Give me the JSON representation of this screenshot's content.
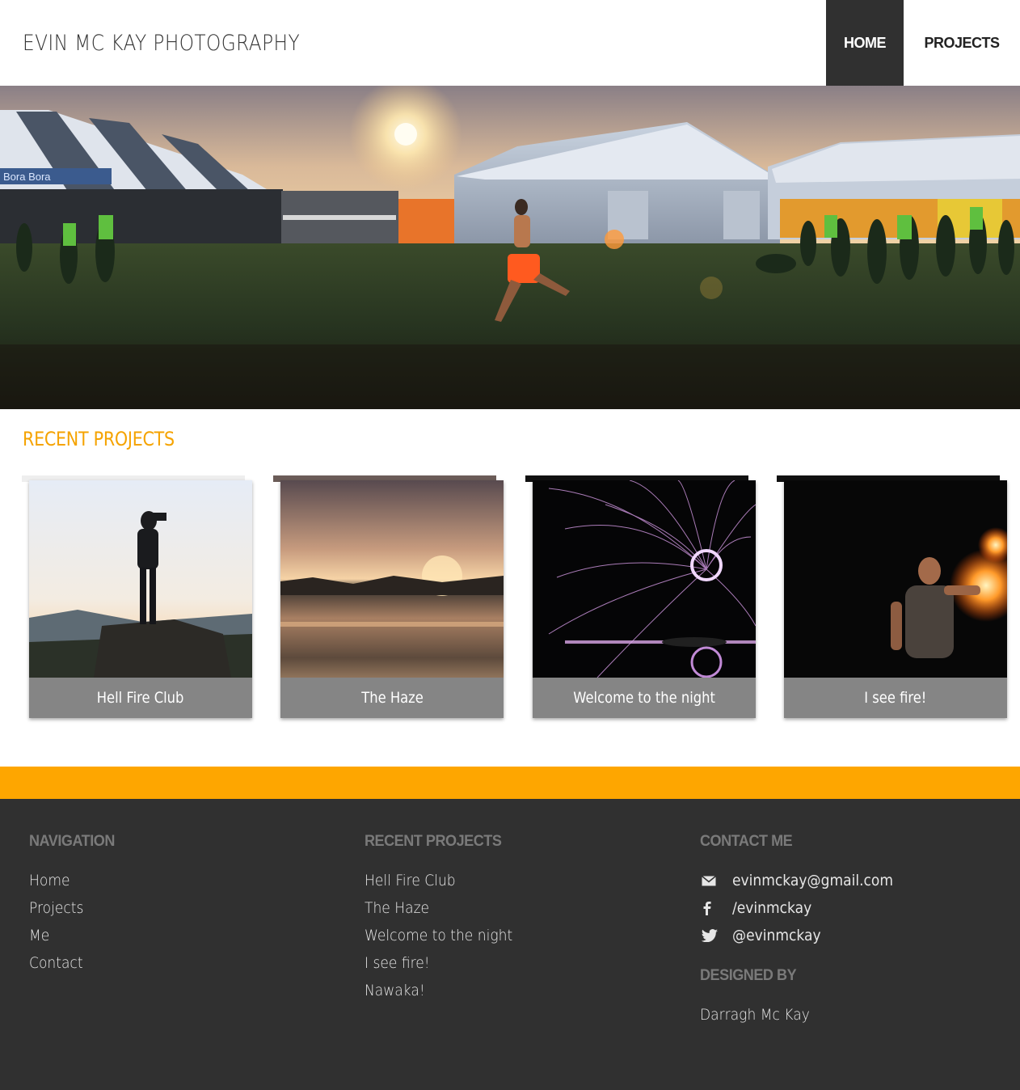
{
  "header": {
    "brand": "EVIN MC KAY PHOTOGRAPHY",
    "nav": [
      {
        "label": "HOME",
        "active": true
      },
      {
        "label": "PROJECTS",
        "active": false
      }
    ]
  },
  "hero": {
    "alt": "Festival campsite at sunset with a runner crossing the field",
    "sign_text": "Bora Bora"
  },
  "recent": {
    "title": "RECENT PROJECTS",
    "projects": [
      {
        "caption": "Hell Fire Club"
      },
      {
        "caption": "The Haze"
      },
      {
        "caption": "Welcome to the night"
      },
      {
        "caption": "I see fire!"
      }
    ]
  },
  "footer": {
    "navigation": {
      "heading": "NAVIGATION",
      "links": [
        "Home",
        "Projects",
        "Me",
        "Contact"
      ]
    },
    "recent_projects": {
      "heading": "RECENT PROJECTS",
      "links": [
        "Hell Fire Club",
        "The Haze",
        "Welcome to the night",
        "I see fire!",
        "Nawaka!"
      ]
    },
    "contact": {
      "heading": "CONTACT ME",
      "email": "evinmckay@gmail.com",
      "facebook": "/evinmckay",
      "twitter": "@evinmckay"
    },
    "designed_by": {
      "heading": "DESIGNED BY",
      "name": "Darragh Mc Kay"
    }
  },
  "colors": {
    "accent": "#fea600",
    "dark": "#303030",
    "title": "#f5a300"
  }
}
